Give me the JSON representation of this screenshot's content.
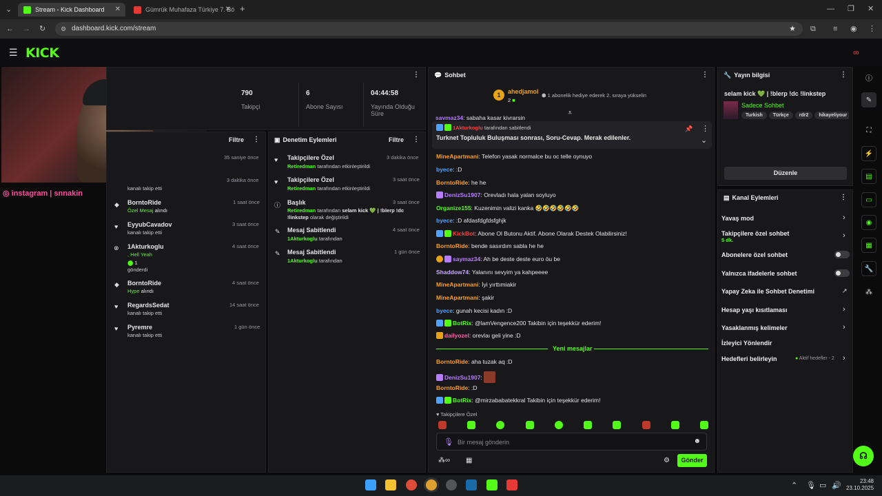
{
  "browser": {
    "tabs": [
      {
        "label": "Stream - Kick Dashboard"
      },
      {
        "label": "Gümrük Muhafaza Türkiye 7. Bö"
      }
    ],
    "url": "dashboard.kick.com/stream"
  },
  "header": {
    "logo": "KICK"
  },
  "webcam": {
    "overlay": "instagram | snnakin"
  },
  "stats": [
    {
      "value": "790",
      "label": "Takipçi"
    },
    {
      "value": "6",
      "label": "Abone Sayısı"
    },
    {
      "value": "04:44:58",
      "label": "Yayında Olduğu Süre"
    }
  ],
  "activity": {
    "filter": "Filtre",
    "items": [
      {
        "time": "35 saniye önce",
        "name": "",
        "detail": ""
      },
      {
        "time": "3 dakika önce",
        "name": "",
        "detail": "kanalı takip etti"
      },
      {
        "time": "1 saat önce",
        "name": "BorntoRide",
        "detail_green": "Özel Mesaj",
        "detail": "alındı"
      },
      {
        "time": "3 saat önce",
        "name": "EyyubCavadov",
        "detail": "kanalı takip etti"
      },
      {
        "time": "4 saat önce",
        "name": "1Akturkoglu",
        "detail_green": ", Hell Yeah",
        "amount": "1",
        "detail": "gönderdi"
      },
      {
        "time": "4 saat önce",
        "name": "BorntoRide",
        "detail_green": "Hype",
        "detail": "alındı"
      },
      {
        "time": "14 saat önce",
        "name": "RegardsSedat",
        "detail": "kanalı takip etti"
      },
      {
        "time": "1 gün önce",
        "name": "Pyremre",
        "detail": "kanalı takip etti"
      }
    ]
  },
  "moderation": {
    "title": "Denetim Eylemleri",
    "filter": "Filtre",
    "items": [
      {
        "title": "Takipçilere Özel",
        "time": "3 dakika önce",
        "by": "Retiredman",
        "rest": "tarafından etkinleştirildi"
      },
      {
        "title": "Takipçilere Özel",
        "time": "3 saat önce",
        "by": "Retiredman",
        "rest": "tarafından etkinleştirildi"
      },
      {
        "title": "Başlık",
        "time": "3 saat önce",
        "by": "Retiredman",
        "rest": "tarafından",
        "bold": "selam kick 💚 | !blerp !dc !linkstep",
        "rest2": "olarak değiştirildi"
      },
      {
        "title": "Mesaj Sabitlendi",
        "time": "4 saat önce",
        "by": "1Akturkoglu",
        "rest": "tarafından"
      },
      {
        "title": "Mesaj Sabitlendi",
        "time": "1 gün önce",
        "by": "1Akturkoglu",
        "rest": "tarafından"
      }
    ]
  },
  "chat": {
    "title": "Sohbet",
    "top_user": "ahedjamol",
    "top_count": "2",
    "top_msg": "1 abonelik hediye ederek 2. sıraya yükselin",
    "cut_user": "saymaz34",
    "cut_msg": "sabaha kasar kivrarsin",
    "pinned_by": "tarafından sabitlendi",
    "pinned_user": "1Akturkoglu",
    "pinned_text": "Turknet Topluluk Buluşması sonrası, Soru-Cevap. Merak edilenler.",
    "messages": [
      {
        "user": "MineApartmani",
        "color": "#ff9f1c",
        "text": "Telefon yasak normalce bu oc telle oynuyo"
      },
      {
        "user": "byece",
        "color": "#4fa3ff",
        "text": ":D"
      },
      {
        "user": "BorntoRide",
        "color": "#ff9f1c",
        "text": "he he"
      },
      {
        "user": "DenizSu1907",
        "color": "#b77dff",
        "text": "Orevladı hala yalan soyluyo"
      },
      {
        "user": "Organize155",
        "color": "#53fc18",
        "text": "Kuzenimin valizi kanka 🤣🤣🤣🤣🤣🤣"
      },
      {
        "user": "byece",
        "color": "#4fa3ff",
        "text": ":D afdasfdgfdsfghjk"
      },
      {
        "user": "KickBot",
        "color": "#ff4040",
        "text": "Abone Ol Butonu Aktif. Abone Olarak Destek Olabilirsiniz!"
      },
      {
        "user": "BorntoRide",
        "color": "#ff9f1c",
        "text": "bende sasırdım sabla he he"
      },
      {
        "user": "saymaz34",
        "color": "#b77dff",
        "text": "Ah be deste deste euro öu be"
      },
      {
        "user": "Shaddow74",
        "color": "#c9a7ff",
        "text": "Yalanını sevyim ya kahpeeee"
      },
      {
        "user": "MineApartmani",
        "color": "#ff9f1c",
        "text": "İyi yırttımiakir"
      },
      {
        "user": "MineApartmani",
        "color": "#ff9f1c",
        "text": "şakir"
      },
      {
        "user": "byece",
        "color": "#4fa3ff",
        "text": "gunah kecisi kadın :D"
      },
      {
        "user": "BotRix",
        "color": "#53fc18",
        "text": "@lamVengence200 Takibin için teşekkür ederim!"
      },
      {
        "user": "dailyozel",
        "color": "#ff5fa8",
        "text": "orevlaı geli yine :D"
      }
    ],
    "new_label": "Yeni mesajlar",
    "new_messages": [
      {
        "user": "BorntoRide",
        "color": "#ff9f1c",
        "text": "aha tuzak aq :D"
      },
      {
        "user": "DenizSu1907",
        "color": "#b77dff",
        "text": ""
      },
      {
        "user": "BorntoRide",
        "color": "#ff9f1c",
        "text": ":D"
      },
      {
        "user": "BotRix",
        "color": "#53fc18",
        "text": "@mirzababatekkral Takibin için teşekkür ederim!"
      }
    ],
    "mode": "Takipçilere Özel",
    "placeholder": "Bir mesaj gönderin",
    "send": "Gönder"
  },
  "streaminfo": {
    "title": "Yayın bilgisi",
    "stream_title": "selam kick 💚 | !blerp !dc !linkstep",
    "category": "Sadece Sohbet",
    "tags": [
      "Turkish",
      "Türkçe",
      "rdr2",
      "hikayeliyour"
    ],
    "edit": "Düzenle"
  },
  "channel": {
    "title": "Kanal Eylemleri",
    "items": [
      {
        "label": "Yavaş mod",
        "kind": "chev"
      },
      {
        "label": "Takipçilere özel sohbet",
        "sub": "5 dk.",
        "kind": "chev"
      },
      {
        "label": "Abonelere özel sohbet",
        "kind": "toggle"
      },
      {
        "label": "Yalnızca ifadelerle sohbet",
        "kind": "toggle"
      },
      {
        "label": "Yapay Zeka ile Sohbet Denetimi",
        "kind": "ext"
      },
      {
        "label": "Hesap yaşı kısıtlaması",
        "kind": "chev"
      },
      {
        "label": "Yasaklanmış kelimeler",
        "kind": "chev"
      },
      {
        "label": "İzleyici Yönlendir",
        "kind": "none"
      },
      {
        "label": "Hedefleri belirleyin",
        "sub_right": "Aktif hedefler - 2",
        "kind": "chev"
      }
    ]
  },
  "taskbar": {
    "time": "23:48",
    "date": "23.10.2025"
  }
}
